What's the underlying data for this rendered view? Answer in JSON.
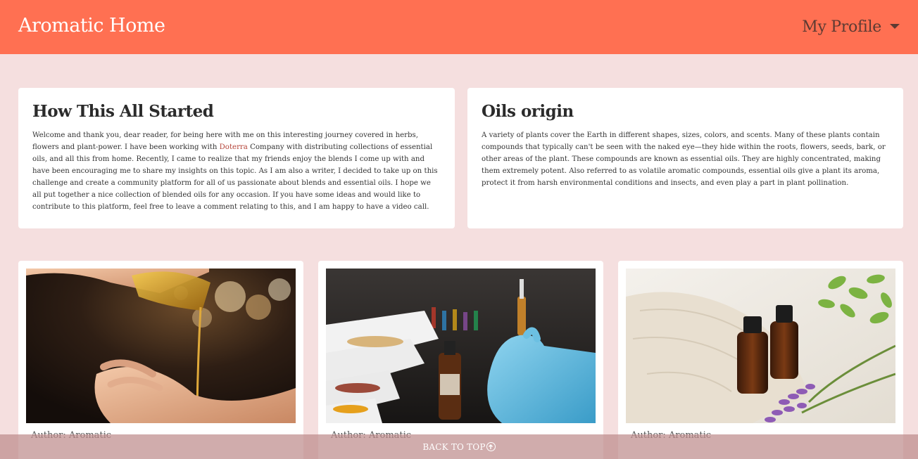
{
  "header": {
    "brand": "Aromatic Home",
    "profile_label": "My Profile"
  },
  "intro_cards": [
    {
      "title": "How This All Started",
      "text_before_link": "Welcome and thank you, dear reader, for being here with me on this interesting journey covered in herbs, flowers and plant-power. I have been working with ",
      "link_text": "Doterra",
      "text_after_link": " Company with distributing collections of essential oils, and all this from home. Recently, I came to realize that my friends enjoy the blends I come up with and have been encouraging me to share my insights on this topic. As I am also a writer, I decided to take up on this challenge and create a community platform for all of us passionate about blends and essential oils. I hope we all put together a nice collection of blended oils for any occasion. If you have some ideas and would like to contribute to this platform, feel free to leave a comment relating to this, and I am happy to have a video call."
    },
    {
      "title": "Oils origin",
      "text": "A variety of plants cover the Earth in different shapes, sizes, colors, and scents. Many of these plants contain compounds that typically can't be seen with the naked eye—they hide within the roots, flowers, seeds, bark, or other areas of the plant. These compounds are known as essential oils. They are highly concentrated, making them extremely potent. Also referred to as volatile aromatic compounds, essential oils give a plant its aroma, protect it from harsh environmental conditions and insects, and even play a part in plant pollination."
    }
  ],
  "posts": [
    {
      "author": "Author: Aromatic",
      "image": "oil-pouring-into-hand"
    },
    {
      "author": "Author: Aromatic",
      "image": "lab-gloved-hand-with-dropper"
    },
    {
      "author": "Author: Aromatic",
      "image": "amber-bottles-with-lavender"
    }
  ],
  "footer": {
    "back_to_top": "BACK TO TOP"
  }
}
